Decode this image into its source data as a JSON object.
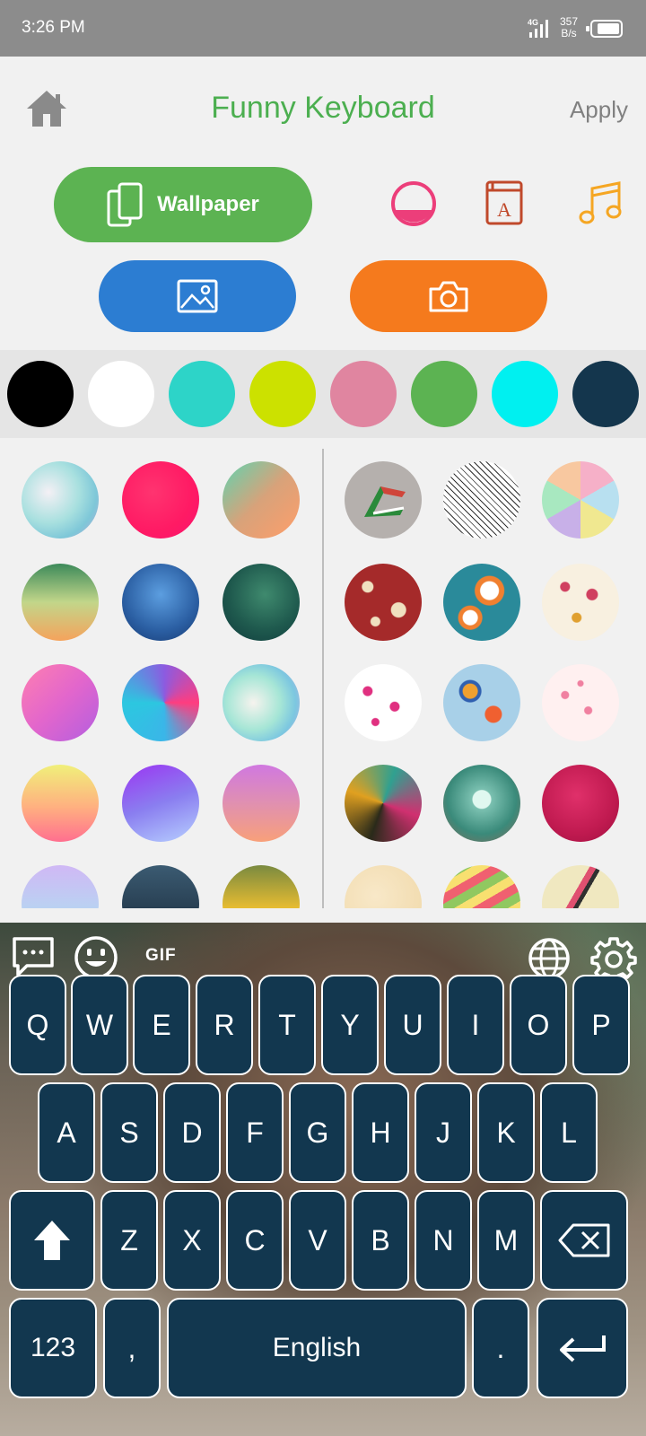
{
  "status": {
    "time": "3:26 PM",
    "network": "4G",
    "speed": "357\nB/s",
    "speed_top": "357",
    "speed_bottom": "B/s"
  },
  "header": {
    "title": "Funny Keyboard",
    "apply_label": "Apply"
  },
  "actions": {
    "wallpaper_label": "Wallpaper"
  },
  "colors": [
    "#000000",
    "#ffffff",
    "#2dd4c8",
    "#cce100",
    "#e085a0",
    "#5cb352",
    "#00f0f0",
    "#14364d"
  ],
  "keyboard": {
    "toolbar": {
      "gif_label": "GIF"
    },
    "row1": [
      "Q",
      "W",
      "E",
      "R",
      "T",
      "Y",
      "U",
      "I",
      "O",
      "P"
    ],
    "row2": [
      "A",
      "S",
      "D",
      "F",
      "G",
      "H",
      "J",
      "K",
      "L"
    ],
    "row3": [
      "Z",
      "X",
      "C",
      "V",
      "B",
      "N",
      "M"
    ],
    "bottom": {
      "numbers": "123",
      "comma": ",",
      "space": "English",
      "period": "."
    }
  }
}
